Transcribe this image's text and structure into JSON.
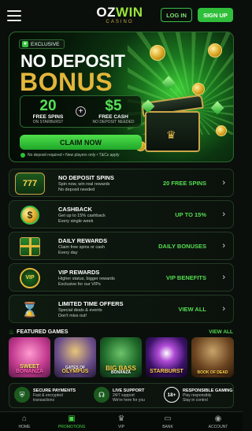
{
  "header": {
    "logo_main": "OZWIN",
    "logo_sub": "CASINO",
    "login_label": "LOG IN",
    "signup_label": "SIGN UP"
  },
  "hero": {
    "badge": "EXCLUSIVE",
    "title_line1": "NO DEPOSIT",
    "title_line2": "BONUS",
    "offer_left_value": "20",
    "offer_left_label": "FREE SPINS",
    "offer_left_sub": "ON STARBURST",
    "offer_right_value": "$5",
    "offer_right_label": "FREE CASH",
    "offer_right_sub": "NO DEPOSIT NEEDED",
    "cta_label": "CLAIM NOW",
    "terms": "No deposit required • New players only • T&Cs apply"
  },
  "promos": [
    {
      "title": "NO DEPOSIT SPINS",
      "desc1": "Spin now, win real rewards",
      "desc2": "No deposit needed",
      "value": "20 FREE SPINS",
      "icon": "777"
    },
    {
      "title": "CASHBACK",
      "desc1": "Get up to 15% cashback",
      "desc2": "Every single week",
      "value": "UP TO 15%",
      "icon": "$"
    },
    {
      "title": "DAILY REWARDS",
      "desc1": "Claim free spins or cash",
      "desc2": "Every day",
      "value": "DAILY BONUSES",
      "icon": "gift"
    },
    {
      "title": "VIP REWARDS",
      "desc1": "Higher status, bigger rewards",
      "desc2": "Exclusive for our VIPs",
      "value": "VIP BENEFITS",
      "icon": "VIP"
    },
    {
      "title": "LIMITED TIME OFFERS",
      "desc1": "Special deals & events",
      "desc2": "Don't miss out!",
      "value": "VIEW ALL",
      "icon": "hourglass"
    }
  ],
  "featured": {
    "title": "FEATURED GAMES",
    "view_all": "VIEW ALL",
    "games": [
      {
        "line1": "SWEET",
        "line2": "BONANZA"
      },
      {
        "line1": "GATES OF",
        "line2": "OLYMPUS"
      },
      {
        "line1": "BIG BASS",
        "line2": "BONANZA"
      },
      {
        "line1": "STARBURST",
        "line2": ""
      },
      {
        "line1": "BOOK OF DEAD",
        "line2": ""
      }
    ]
  },
  "trust": [
    {
      "title": "SECURE PAYMENTS",
      "l1": "Fast & encrypted",
      "l2": "transactions"
    },
    {
      "title": "LIVE SUPPORT",
      "l1": "24/7 support",
      "l2": "We're here for you"
    },
    {
      "title": "RESPONSIBLE GAMING",
      "l1": "Play responsibly",
      "l2": "Stay in control"
    },
    {
      "badge": "18+"
    }
  ],
  "nav": {
    "home": "HOME",
    "promotions": "PROMOTIONS",
    "vip": "VIP",
    "bank": "BANK",
    "account": "ACCOUNT"
  },
  "colors": {
    "accent": "#2fbf3a",
    "gold": "#e3b63a",
    "background": "#0a0f0b"
  }
}
